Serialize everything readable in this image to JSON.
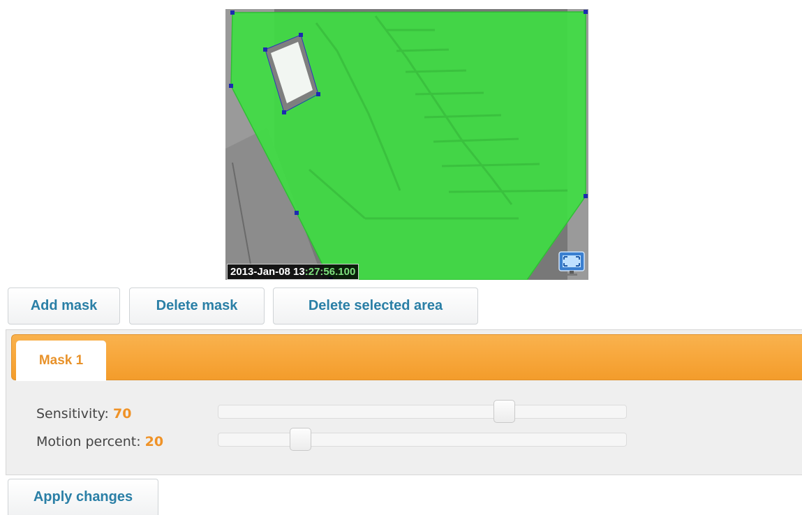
{
  "camera": {
    "timestamp_white": "2013-Jan-08 13",
    "timestamp_green": ":27:56.100",
    "fullscreen_icon": "fullscreen-monitor-icon"
  },
  "toolbar": {
    "add_mask_label": "Add mask",
    "delete_mask_label": "Delete mask",
    "delete_area_label": "Delete selected area"
  },
  "tabs": [
    {
      "label": "Mask 1",
      "active": true
    }
  ],
  "settings": {
    "sensitivity_label": "Sensitivity:",
    "sensitivity_value": "70",
    "sensitivity_level": 70,
    "motion_label": "Motion percent:",
    "motion_value": "20",
    "motion_level": 20
  },
  "footer": {
    "apply_label": "Apply changes"
  },
  "colors": {
    "accent": "#f7a63a",
    "link": "#2a7fa6",
    "value": "#ef9227",
    "mask": "#3fdd44",
    "timestamp_green": "#7ee07e"
  }
}
